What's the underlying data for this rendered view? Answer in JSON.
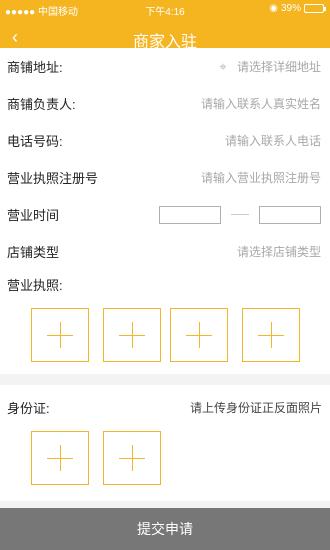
{
  "status_bar": {
    "carrier": "●●●●● 中国移动 ",
    "time": "下午4:16",
    "battery_text": "39%"
  },
  "header": {
    "back_symbol": "‹",
    "title": "商家入驻"
  },
  "form": {
    "address_label": "商铺地址:",
    "address_placeholder": "请选择详细地址",
    "owner_label": "商铺负责人:",
    "owner_placeholder": "请输入联系人真实姓名",
    "phone_label": "电话号码:",
    "phone_placeholder": "请输入联系人电话",
    "license_no_label": "营业执照注册号",
    "license_no_placeholder": "请输入营业执照注册号",
    "hours_label": "营业时间",
    "hours_separator": "—",
    "type_label": "店铺类型",
    "type_placeholder": "请选择店铺类型"
  },
  "license_section": {
    "title": "营业执照:"
  },
  "id_section": {
    "title": "身份证:",
    "hint": "请上传身份证正反面照片"
  },
  "submit": {
    "label": "提交申请"
  },
  "icons": {
    "location": "location-pin-icon",
    "wifi": "wifi-icon",
    "battery": "battery-icon"
  },
  "colors": {
    "header": "#f5b521",
    "upload_border": "#f0b72a",
    "submit": "#777777"
  }
}
